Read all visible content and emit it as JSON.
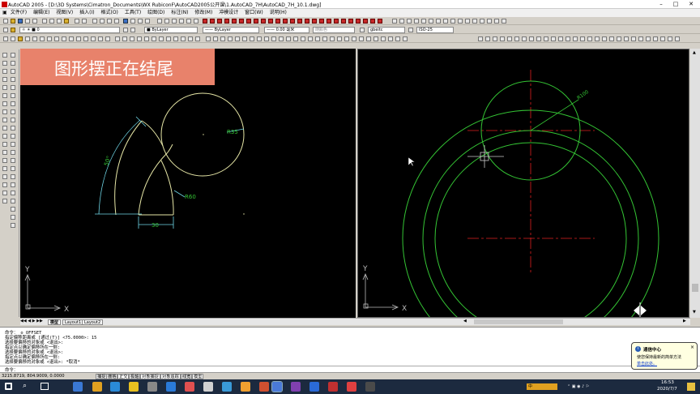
{
  "window": {
    "title": "AutoCAD 2005 - [D:\\3D Systems\\Cimatron_Documents\\WX RubiconF\\AutoCAD2005公开课\\1.AutoCAD_7H\\AutoCAD_7H_10.1.dwg]",
    "minimize": "–",
    "maximize": "□",
    "close": "✕"
  },
  "menu": [
    "文件(F)",
    "编辑(E)",
    "视图(V)",
    "插入(I)",
    "格式(O)",
    "工具(T)",
    "绘图(D)",
    "标注(N)",
    "修改(M)",
    "冲模设计",
    "窗口(W)",
    "说明(H)"
  ],
  "toolbar": {
    "layer_value": "0",
    "color_value": "ByLayer",
    "linetype_value": "ByLayer",
    "lineweight_value": "0.00 毫米",
    "plotstyle_value": "随颜色",
    "textstyle_value": "gbeitc",
    "dimstyle_value": "ISO-25"
  },
  "banner": {
    "text": "图形摆正在结尾"
  },
  "drawing_left": {
    "labels": {
      "r35": "R35",
      "r60": "R60",
      "angle": "50°",
      "width": "30"
    },
    "ucs": {
      "x": "X",
      "y": "Y"
    }
  },
  "drawing_right": {
    "labels": {
      "r100": "R100"
    },
    "ucs": {
      "x": "X",
      "y": "Y"
    }
  },
  "layout_tabs": [
    "模型",
    "Layout1",
    "Layout2"
  ],
  "command_history": [
    "命令：_o OFFSET",
    "指定偏移距离或 [通过(T)] <75.0000>: 15",
    "选择要偏移的对象或 <退出>:",
    "指定点以确定偏移所在一侧:",
    "选择要偏移的对象或 <退出>:",
    "指定点以确定偏移所在一侧:",
    "选择要偏移的对象或 <退出>: *取消*"
  ],
  "command_prompt": "命令：",
  "status": {
    "coords": "3215.8719, 804.9009, 0.0000",
    "buttons": [
      "捕捉",
      "栅格",
      "正交",
      "极轴",
      "对象捕捉",
      "对象追踪",
      "线宽",
      "模型"
    ]
  },
  "notification": {
    "title": "通信中心",
    "body": "使您保持最新的简单方法",
    "link": "单击此处。",
    "close": "×"
  },
  "taskbar": {
    "time": "16:53",
    "date": "2020/7/7",
    "ime": "中"
  },
  "colors": {
    "banner_bg": "#e8826b",
    "drawing_yellow": "#e6e6a6",
    "drawing_cyan": "#6fd6e6",
    "drawing_green": "#34c434",
    "centerline_red": "#e02020"
  }
}
